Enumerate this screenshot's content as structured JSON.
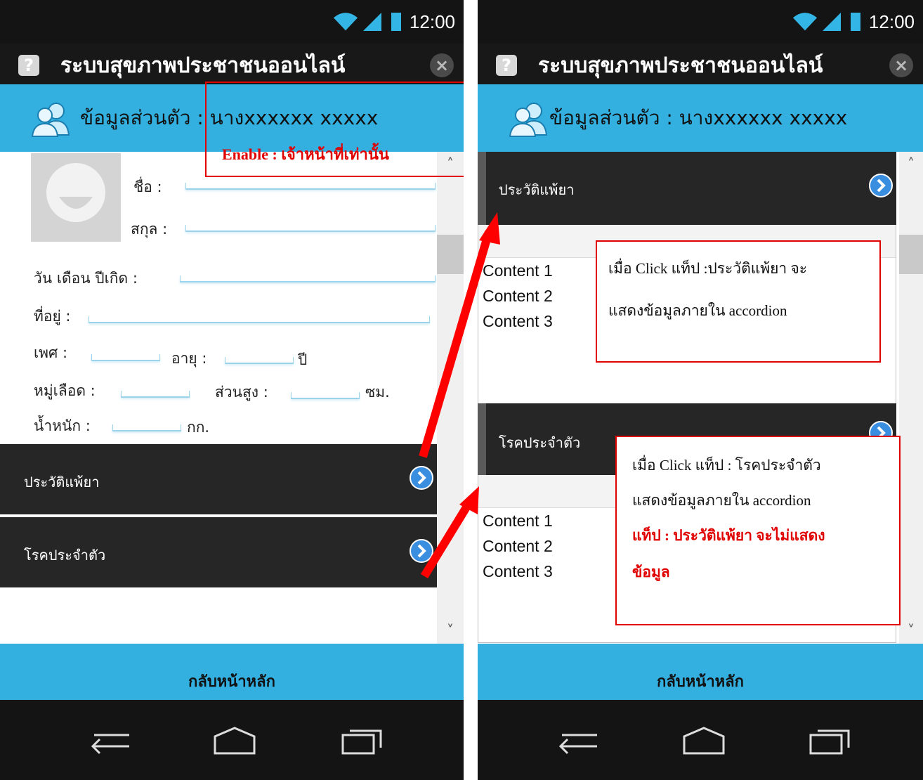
{
  "status": {
    "time": "12:00"
  },
  "app": {
    "title": "ระบบสุขภาพประชาชนออนไลน์"
  },
  "header": {
    "title": "ข้อมูลส่วนตัว : นางxxxxxx xxxxx"
  },
  "form": {
    "first_name_label": "ชื่อ :",
    "last_name_label": "สกุล :",
    "birthdate_label": "วัน เดือน ปีเกิด :",
    "address_label": "ที่อยู่ :",
    "sex_label": "เพศ :",
    "age_label": "อายุ :",
    "age_unit": "ปี",
    "blood_label": "หมู่เลือด :",
    "height_label": "ส่วนสูง :",
    "height_unit": "ซม.",
    "weight_label": "น้ำหนัก :",
    "weight_unit": "กก."
  },
  "accordion": {
    "allergy_label": "ประวัติแพ้ยา",
    "disease_label": "โรคประจำตัว",
    "contents": [
      "Content 1",
      "Content 2",
      "Content 3"
    ]
  },
  "footer": {
    "back_label": "กลับหน้าหลัก"
  },
  "annotations": {
    "enable": "Enable : เจ้าหน้าที่เท่านั้น",
    "allergy_line1": "เมื่อ Click แท็ป :ประวัติแพ้ยา จะ",
    "allergy_line2": "แสดงข้อมูลภายใน accordion",
    "disease_line1": "เมื่อ Click แท็ป : โรคประจำตัว",
    "disease_line2": "แสดงข้อมูลภายใน accordion",
    "disease_line3": "แท็ป : ประวัติแพ้ยา จะไม่แสดง",
    "disease_line4": "ข้อมูล"
  },
  "colors": {
    "accent": "#33b0e0",
    "dark": "#262626",
    "annotation": "#e00000"
  }
}
